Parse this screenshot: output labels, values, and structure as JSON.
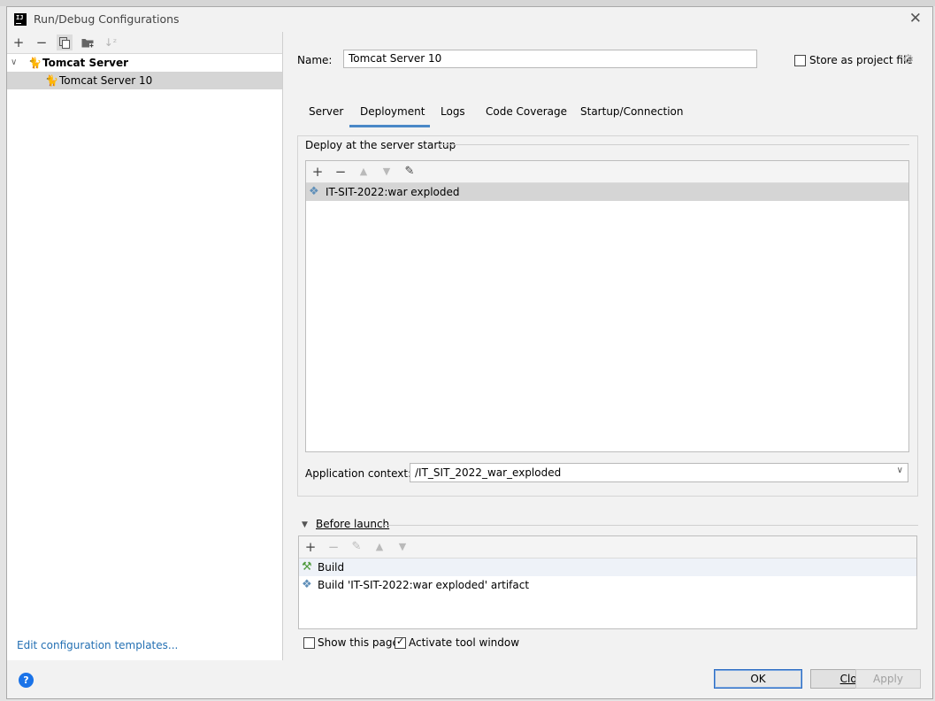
{
  "window": {
    "title": "Run/Debug Configurations",
    "app_logo_text": "IJ"
  },
  "left_toolbar": {
    "add_icon": "plus-icon",
    "remove_icon": "minus-icon",
    "copy_icon": "copy-icon",
    "folder_icon": "folder-icon",
    "sort_icon": "sort-icon"
  },
  "tree": {
    "group_label": "Tomcat Server",
    "item_label": "Tomcat Server 10"
  },
  "edit_templates_link": "Edit configuration templates...",
  "name_label": "Name:",
  "name_value": "Tomcat Server 10",
  "store_as_project_file": {
    "label": "Store as project file",
    "checked": false
  },
  "tabs": [
    "Server",
    "Deployment",
    "Logs",
    "Code Coverage",
    "Startup/Connection"
  ],
  "active_tab": "Deployment",
  "deploy": {
    "title": "Deploy at the server startup",
    "items": [
      "IT-SIT-2022:war exploded"
    ]
  },
  "application_context": {
    "label": "Application context:",
    "value": "/IT_SIT_2022_war_exploded"
  },
  "before_launch": {
    "title": "Before launch",
    "items": [
      "Build",
      "Build 'IT-SIT-2022:war exploded' artifact"
    ]
  },
  "show_this_page": {
    "label": "Show this page",
    "checked": false
  },
  "activate_tool_window": {
    "label": "Activate tool window",
    "checked": true
  },
  "buttons": {
    "ok": "OK",
    "close": "Close",
    "apply": "Apply"
  },
  "colors": {
    "accent": "#4a88c7",
    "link": "#2470b3",
    "selection": "#d5d5d5"
  }
}
